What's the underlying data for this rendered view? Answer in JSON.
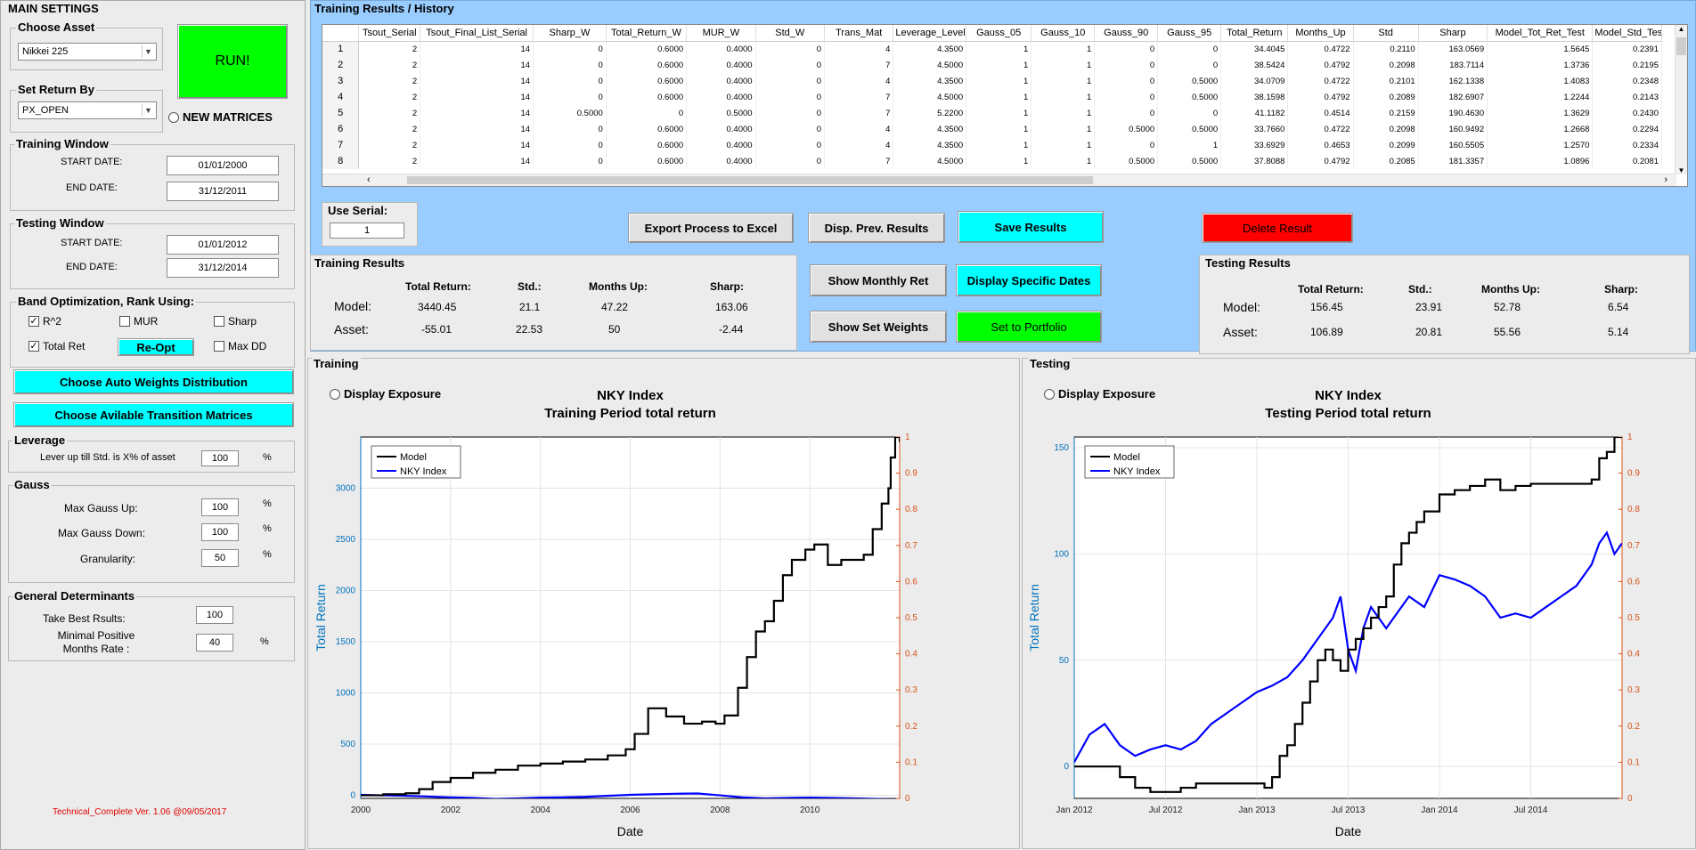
{
  "main_settings": {
    "title": "MAIN SETTINGS",
    "choose_asset": {
      "title": "Choose Asset",
      "value": "Nikkei 225"
    },
    "run_label": "RUN!",
    "set_return_by": {
      "title": "Set Return By",
      "value": "PX_OPEN"
    },
    "new_matrices_label": "NEW MATRICES",
    "training_window": {
      "title": "Training Window",
      "start_label": "START DATE:",
      "start_value": "01/01/2000",
      "end_label": "END DATE:",
      "end_value": "31/12/2011"
    },
    "testing_window": {
      "title": "Testing Window",
      "start_label": "START DATE:",
      "start_value": "01/01/2012",
      "end_label": "END DATE:",
      "end_value": "31/12/2014"
    },
    "band_opt": {
      "title": "Band Optimization, Rank Using:",
      "r2": "R^2",
      "mur": "MUR",
      "sharp": "Sharp",
      "total_ret": "Total Ret",
      "reopt": "Re-Opt",
      "max_dd": "Max DD"
    },
    "auto_weights_label": "Choose Auto Weights Distribution",
    "transition_label": "Choose Avilable Transition Matrices",
    "leverage": {
      "title": "Leverage",
      "label": "Lever up till Std. is X% of asset",
      "value": "100",
      "unit": "%"
    },
    "gauss": {
      "title": "Gauss",
      "up_label": "Max Gauss Up:",
      "up_value": "100",
      "down_label": "Max Gauss Down:",
      "down_value": "100",
      "gran_label": "Granularity:",
      "gran_value": "50",
      "unit": "%"
    },
    "general": {
      "title": "General Determinants",
      "best_label": "Take Best Rsults:",
      "best_value": "100",
      "min_label": "Minimal Positive Months Rate :",
      "min_value": "40",
      "unit": "%"
    },
    "version": "Technical_Complete Ver. 1.06 @09/05/2017"
  },
  "history": {
    "title": "Training Results / History",
    "columns": [
      "Tsout_Serial",
      "Tsout_Final_List_Serial",
      "Sharp_W",
      "Total_Return_W",
      "MUR_W",
      "Std_W",
      "Trans_Mat",
      "Leverage_Level",
      "Gauss_05",
      "Gauss_10",
      "Gauss_90",
      "Gauss_95",
      "Total_Return",
      "Months_Up",
      "Std",
      "Sharp",
      "Model_Tot_Ret_Test",
      "Model_Std_Test"
    ],
    "rows": [
      [
        "1",
        "2",
        "14",
        "0",
        "0.6000",
        "0.4000",
        "0",
        "4",
        "4.3500",
        "1",
        "1",
        "0",
        "0",
        "34.4045",
        "0.4722",
        "0.2110",
        "163.0569",
        "1.5645",
        "0.2391"
      ],
      [
        "2",
        "2",
        "14",
        "0",
        "0.6000",
        "0.4000",
        "0",
        "7",
        "4.5000",
        "1",
        "1",
        "0",
        "0",
        "38.5424",
        "0.4792",
        "0.2098",
        "183.7114",
        "1.3736",
        "0.2195"
      ],
      [
        "3",
        "2",
        "14",
        "0",
        "0.6000",
        "0.4000",
        "0",
        "4",
        "4.3500",
        "1",
        "1",
        "0",
        "0.5000",
        "34.0709",
        "0.4722",
        "0.2101",
        "162.1338",
        "1.4083",
        "0.2348"
      ],
      [
        "4",
        "2",
        "14",
        "0",
        "0.6000",
        "0.4000",
        "0",
        "7",
        "4.5000",
        "1",
        "1",
        "0",
        "0.5000",
        "38.1598",
        "0.4792",
        "0.2089",
        "182.6907",
        "1.2244",
        "0.2143"
      ],
      [
        "5",
        "2",
        "14",
        "0.5000",
        "0",
        "0.5000",
        "0",
        "7",
        "5.2200",
        "1",
        "1",
        "0",
        "0",
        "41.1182",
        "0.4514",
        "0.2159",
        "190.4630",
        "1.3629",
        "0.2430"
      ],
      [
        "6",
        "2",
        "14",
        "0",
        "0.6000",
        "0.4000",
        "0",
        "4",
        "4.3500",
        "1",
        "1",
        "0.5000",
        "0.5000",
        "33.7660",
        "0.4722",
        "0.2098",
        "160.9492",
        "1.2668",
        "0.2294"
      ],
      [
        "7",
        "2",
        "14",
        "0",
        "0.6000",
        "0.4000",
        "0",
        "4",
        "4.3500",
        "1",
        "1",
        "0",
        "1",
        "33.6929",
        "0.4653",
        "0.2099",
        "160.5505",
        "1.2570",
        "0.2334"
      ],
      [
        "8",
        "2",
        "14",
        "0",
        "0.6000",
        "0.4000",
        "0",
        "7",
        "4.5000",
        "1",
        "1",
        "0.5000",
        "0.5000",
        "37.8088",
        "0.4792",
        "0.2085",
        "181.3357",
        "1.0896",
        "0.2081"
      ]
    ]
  },
  "use_serial": {
    "title": "Use Serial:",
    "value": "1"
  },
  "buttons": {
    "export": "Export Process to Excel",
    "disp_prev": "Disp. Prev. Results",
    "save": "Save Results",
    "delete": "Delete Result",
    "monthly": "Show Monthly Ret",
    "specific_dates": "Display Specific Dates",
    "set_weights": "Show Set Weights",
    "set_portfolio": "Set to Portfolio"
  },
  "training_results": {
    "title": "Training Results",
    "headers": [
      "Total Return:",
      "Std.:",
      "Months Up:",
      "Sharp:"
    ],
    "model_label": "Model:",
    "model": [
      "3440.45",
      "21.1",
      "47.22",
      "163.06"
    ],
    "asset_label": "Asset:",
    "asset": [
      "-55.01",
      "22.53",
      "50",
      "-2.44"
    ]
  },
  "testing_results": {
    "title": "Testing Results",
    "headers": [
      "Total Return:",
      "Std.:",
      "Months Up:",
      "Sharp:"
    ],
    "model_label": "Model:",
    "model": [
      "156.45",
      "23.91",
      "52.78",
      "6.54"
    ],
    "asset_label": "Asset:",
    "asset": [
      "106.89",
      "20.81",
      "55.56",
      "5.14"
    ]
  },
  "training_chart": {
    "panel_title": "Training",
    "display_exposure": "Display Exposure"
  },
  "testing_chart": {
    "panel_title": "Testing",
    "display_exposure": "Display Exposure"
  },
  "colors": {
    "green": "#00ff00",
    "cyan": "#00ffff",
    "red": "#ff0000",
    "blue_bg": "#99ccff",
    "model": "#000000",
    "index": "#0000ff",
    "left_axis": "#0072bd",
    "right_axis": "#d95319"
  },
  "chart_data": [
    {
      "type": "line",
      "title": "NKY Index",
      "subtitle": "Training Period total return",
      "xlabel": "Date",
      "ylabel": "Total Return",
      "xticks": [
        "2000",
        "2002",
        "2004",
        "2006",
        "2008",
        "2010"
      ],
      "yticks": [
        "0",
        "500",
        "1000",
        "1500",
        "2000",
        "2500",
        "3000"
      ],
      "y2ticks": [
        "0",
        "0.1",
        "0.2",
        "0.3",
        "0.4",
        "0.5",
        "0.6",
        "0.7",
        "0.8",
        "0.9",
        "1"
      ],
      "xlim": [
        2000,
        2012
      ],
      "ylim": [
        -30,
        3500
      ],
      "y2lim": [
        0,
        1
      ],
      "legend": "top-left",
      "grid": true,
      "series": [
        {
          "name": "Model",
          "color": "#000000",
          "x": [
            2000,
            2000.5,
            2001,
            2001.3,
            2001.6,
            2002,
            2002.5,
            2003,
            2003.5,
            2004,
            2004.5,
            2005,
            2005.5,
            2005.9,
            2006.1,
            2006.4,
            2006.8,
            2007.2,
            2007.6,
            2007.9,
            2008.1,
            2008.4,
            2008.6,
            2008.8,
            2009.0,
            2009.2,
            2009.4,
            2009.6,
            2009.9,
            2010.1,
            2010.4,
            2010.7,
            2011.0,
            2011.2,
            2011.4,
            2011.6,
            2011.75,
            2011.8,
            2011.9,
            2012
          ],
          "y": [
            0,
            10,
            20,
            60,
            130,
            170,
            220,
            250,
            290,
            310,
            330,
            350,
            390,
            450,
            600,
            850,
            770,
            700,
            720,
            700,
            780,
            1050,
            1350,
            1600,
            1700,
            1900,
            2150,
            2300,
            2400,
            2450,
            2250,
            2300,
            2300,
            2350,
            2600,
            2850,
            3000,
            3300,
            3500,
            3450
          ]
        },
        {
          "name": "NKY Index",
          "color": "#0000ff",
          "x": [
            2000,
            2000.5,
            2001,
            2001.5,
            2002,
            2002.5,
            2003,
            2003.5,
            2004,
            2004.5,
            2005,
            2005.5,
            2006,
            2006.5,
            2007,
            2007.5,
            2008,
            2008.5,
            2009,
            2009.5,
            2010,
            2010.5,
            2011,
            2011.5,
            2012
          ],
          "y": [
            5,
            0,
            -5,
            -12,
            -20,
            -25,
            -35,
            -30,
            -22,
            -20,
            -15,
            -5,
            5,
            10,
            15,
            18,
            0,
            -20,
            -30,
            -25,
            -22,
            -25,
            -30,
            -35,
            -40
          ]
        }
      ]
    },
    {
      "type": "line",
      "title": "NKY Index",
      "subtitle": "Testing Period total return",
      "xlabel": "Date",
      "ylabel": "Total Return",
      "xticks": [
        "Jan 2012",
        "Jul 2012",
        "Jan 2013",
        "Jul 2013",
        "Jan 2014",
        "Jul 2014"
      ],
      "yticks": [
        "0",
        "50",
        "100",
        "150"
      ],
      "y2ticks": [
        "0",
        "0.1",
        "0.2",
        "0.3",
        "0.4",
        "0.5",
        "0.6",
        "0.7",
        "0.8",
        "0.9",
        "1"
      ],
      "xlim": [
        0,
        36
      ],
      "ylim": [
        -15,
        155
      ],
      "y2lim": [
        0,
        1
      ],
      "legend": "top-left",
      "grid": true,
      "series": [
        {
          "name": "Model",
          "color": "#000000",
          "x": [
            0,
            1,
            2,
            3,
            4,
            5,
            6,
            7,
            8,
            9,
            10,
            11,
            12,
            12.5,
            13,
            13.5,
            14,
            14.5,
            15,
            15.5,
            16,
            16.5,
            17,
            17.5,
            18,
            18.5,
            19,
            19.5,
            20,
            20.5,
            21,
            21.5,
            22,
            22.5,
            23,
            24,
            25,
            26,
            27,
            28,
            29,
            30,
            31,
            32,
            33,
            33.5,
            34,
            34.5,
            35,
            35.5,
            36
          ],
          "y": [
            0,
            0,
            0,
            -5,
            -10,
            -12,
            -12,
            -10,
            -8,
            -8,
            -8,
            -8,
            -8,
            -10,
            -5,
            5,
            10,
            20,
            30,
            40,
            50,
            55,
            50,
            45,
            55,
            60,
            65,
            70,
            75,
            80,
            95,
            105,
            110,
            115,
            120,
            128,
            130,
            132,
            135,
            130,
            132,
            133,
            133,
            133,
            133,
            133,
            135,
            145,
            148,
            155,
            155
          ]
        },
        {
          "name": "NKY Index",
          "color": "#0000ff",
          "x": [
            0,
            1,
            2,
            3,
            4,
            5,
            6,
            7,
            8,
            9,
            10,
            11,
            12,
            13,
            14,
            15,
            16,
            17,
            17.5,
            18,
            18.5,
            19,
            19.5,
            20,
            20.5,
            21,
            22,
            23,
            24,
            25,
            26,
            27,
            28,
            29,
            30,
            31,
            32,
            33,
            34,
            34.5,
            35,
            35.5,
            36
          ],
          "y": [
            2,
            15,
            20,
            10,
            5,
            8,
            10,
            8,
            12,
            20,
            25,
            30,
            35,
            38,
            42,
            50,
            60,
            70,
            80,
            55,
            45,
            65,
            75,
            70,
            65,
            70,
            80,
            75,
            90,
            88,
            85,
            80,
            70,
            72,
            70,
            75,
            80,
            85,
            95,
            105,
            110,
            100,
            105
          ]
        }
      ]
    }
  ]
}
